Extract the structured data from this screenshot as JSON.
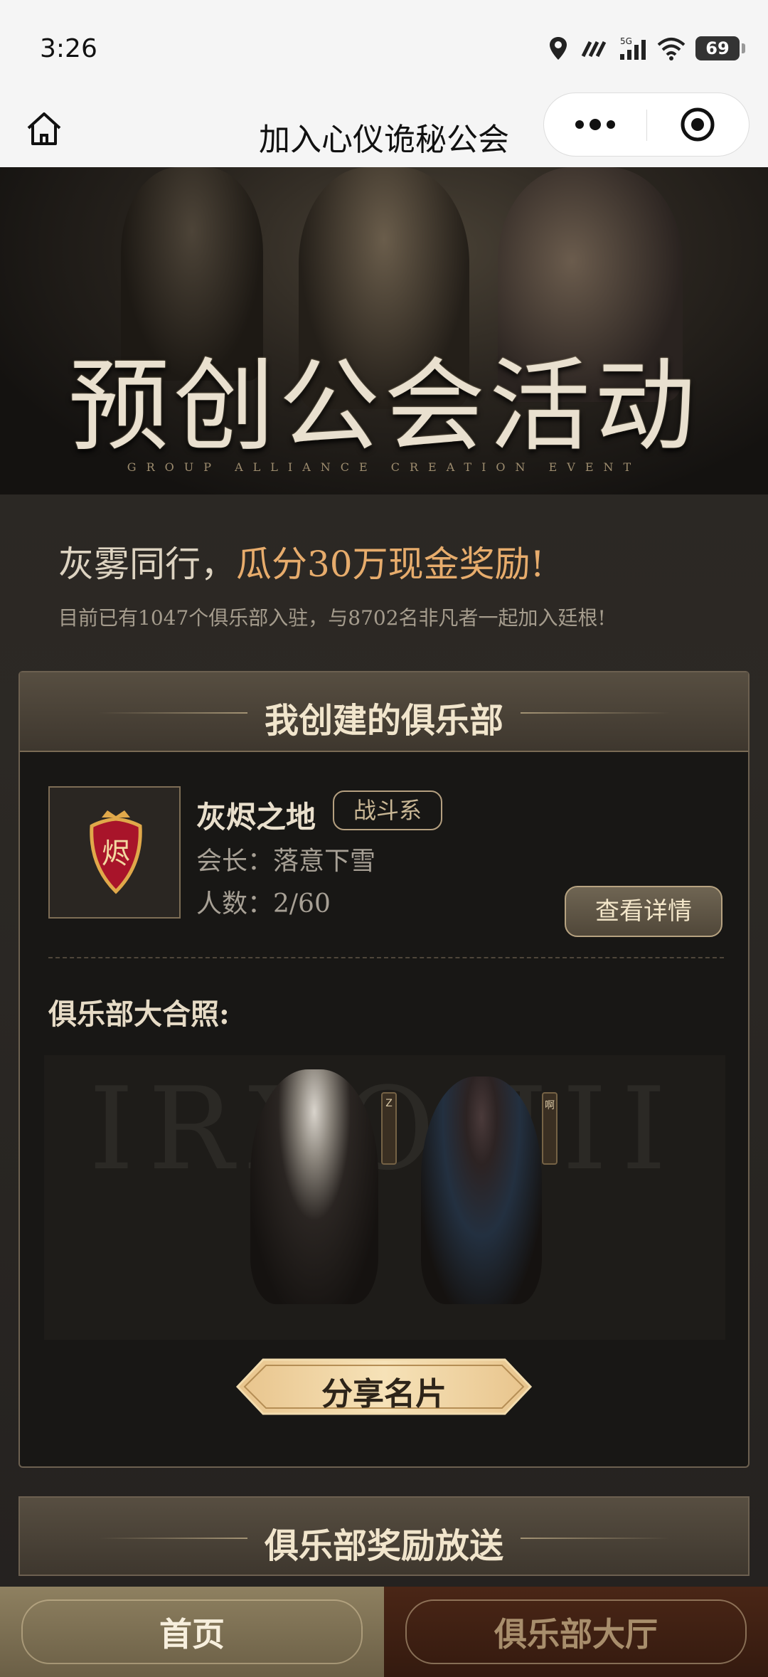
{
  "status_bar": {
    "time": "3:26",
    "battery": "69",
    "network": "5G"
  },
  "nav": {
    "title": "加入心仪诡秘公会"
  },
  "banner": {
    "title": "预创公会活动",
    "subtitle": "GROUP ALLIANCE CREATION EVENT"
  },
  "intro": {
    "slogan_a": "灰雾同行，",
    "slogan_b": "瓜分30万现金奖励!",
    "subline": "目前已有1047个俱乐部入驻，与8702名非凡者一起加入廷根!"
  },
  "my_club": {
    "header": "我创建的俱乐部",
    "emblem_char": "烬",
    "name": "灰烬之地",
    "tag": "战斗系",
    "leader": "会长：落意下雪",
    "count": "人数：2/60",
    "detail_button": "查看详情",
    "photo_label": "俱乐部大合照:",
    "photo_bg_text": "IRXOHII",
    "member_tags": [
      "Z",
      "啊"
    ],
    "share_button": "分享名片"
  },
  "rewards": {
    "header": "俱乐部奖励放送"
  },
  "tabbar": {
    "home": "首页",
    "hall": "俱乐部大厅"
  },
  "colors": {
    "accent_gold": "#e7ac6c",
    "panel_header": "#574e41",
    "emblem_red": "#a8142a"
  }
}
